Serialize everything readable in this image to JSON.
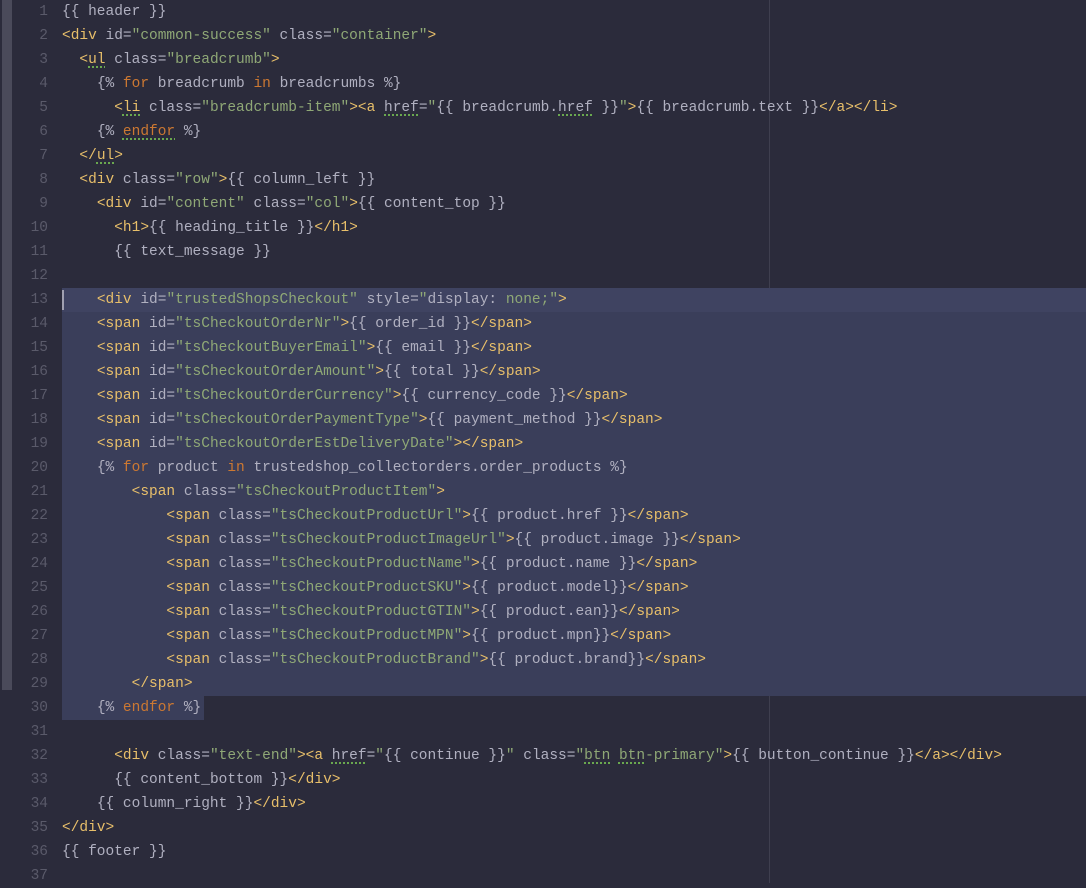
{
  "lines": [
    {
      "num": 1,
      "hl": false
    },
    {
      "num": 2,
      "hl": false
    },
    {
      "num": 3,
      "hl": false
    },
    {
      "num": 4,
      "hl": false
    },
    {
      "num": 5,
      "hl": false
    },
    {
      "num": 6,
      "hl": false
    },
    {
      "num": 7,
      "hl": false
    },
    {
      "num": 8,
      "hl": false
    },
    {
      "num": 9,
      "hl": false
    },
    {
      "num": 10,
      "hl": false
    },
    {
      "num": 11,
      "hl": false
    },
    {
      "num": 12,
      "hl": false
    },
    {
      "num": 13,
      "hl": true
    },
    {
      "num": 14,
      "hl": true
    },
    {
      "num": 15,
      "hl": true
    },
    {
      "num": 16,
      "hl": true
    },
    {
      "num": 17,
      "hl": true
    },
    {
      "num": 18,
      "hl": true
    },
    {
      "num": 19,
      "hl": true
    },
    {
      "num": 20,
      "hl": true
    },
    {
      "num": 21,
      "hl": true
    },
    {
      "num": 22,
      "hl": true
    },
    {
      "num": 23,
      "hl": true
    },
    {
      "num": 24,
      "hl": true
    },
    {
      "num": 25,
      "hl": true
    },
    {
      "num": 26,
      "hl": true
    },
    {
      "num": 27,
      "hl": true
    },
    {
      "num": 28,
      "hl": true
    },
    {
      "num": 29,
      "hl": true
    },
    {
      "num": 30,
      "hl": "partial"
    },
    {
      "num": 31,
      "hl": false
    },
    {
      "num": 32,
      "hl": false
    },
    {
      "num": 33,
      "hl": false
    },
    {
      "num": 34,
      "hl": false
    },
    {
      "num": 35,
      "hl": false
    },
    {
      "num": 36,
      "hl": false
    },
    {
      "num": 37,
      "hl": false
    }
  ],
  "code": {
    "l1": "{{ header }}",
    "l2": "<div id=\"common-success\" class=\"container\">",
    "l3": "  <ul class=\"breadcrumb\">",
    "l4": "    {% for breadcrumb in breadcrumbs %}",
    "l5": "      <li class=\"breadcrumb-item\"><a href=\"{{ breadcrumb.href }}\">{{ breadcrumb.text }}</a></li>",
    "l6": "    {% endfor %}",
    "l7": "  </ul>",
    "l8": "  <div class=\"row\">{{ column_left }}",
    "l9": "    <div id=\"content\" class=\"col\">{{ content_top }}",
    "l10": "      <h1>{{ heading_title }}</h1>",
    "l11": "      {{ text_message }}",
    "l12": "",
    "l13": "    <div id=\"trustedShopsCheckout\" style=\"display: none;\">",
    "l14": "    <span id=\"tsCheckoutOrderNr\">{{ order_id }}</span>",
    "l15": "    <span id=\"tsCheckoutBuyerEmail\">{{ email }}</span>",
    "l16": "    <span id=\"tsCheckoutOrderAmount\">{{ total }}</span>",
    "l17": "    <span id=\"tsCheckoutOrderCurrency\">{{ currency_code }}</span>",
    "l18": "    <span id=\"tsCheckoutOrderPaymentType\">{{ payment_method }}</span>",
    "l19": "    <span id=\"tsCheckoutOrderEstDeliveryDate\"></span>",
    "l20": "    {% for product in trustedshop_collectorders.order_products %}",
    "l21": "        <span class=\"tsCheckoutProductItem\">",
    "l22": "            <span class=\"tsCheckoutProductUrl\">{{ product.href }}</span>",
    "l23": "            <span class=\"tsCheckoutProductImageUrl\">{{ product.image }}</span>",
    "l24": "            <span class=\"tsCheckoutProductName\">{{ product.name }}</span>",
    "l25": "            <span class=\"tsCheckoutProductSKU\">{{ product.model}}</span>",
    "l26": "            <span class=\"tsCheckoutProductGTIN\">{{ product.ean}}</span>",
    "l27": "            <span class=\"tsCheckoutProductMPN\">{{ product.mpn}}</span>",
    "l28": "            <span class=\"tsCheckoutProductBrand\">{{ product.brand}}</span>",
    "l29": "        </span>",
    "l30": "    {% endfor %}",
    "l31": "",
    "l32": "      <div class=\"text-end\"><a href=\"{{ continue }}\" class=\"btn btn-primary\">{{ button_continue }}</a></div>",
    "l33": "      {{ content_bottom }}</div>",
    "l34": "    {{ column_right }}</div>",
    "l35": "</div>",
    "l36": "{{ footer }}",
    "l37": ""
  }
}
